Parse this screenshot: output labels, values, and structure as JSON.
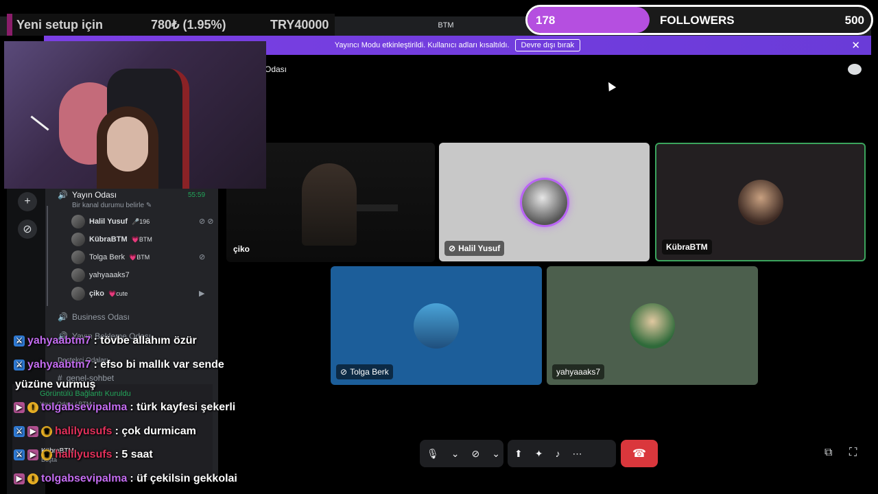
{
  "window": {
    "title": "BTM",
    "controls": [
      "⚑",
      "▣",
      "?",
      "–",
      "□"
    ]
  },
  "banner": {
    "text": "Yayıncı Modu etkinleştirildi. Kullanıcı adları kısaltıldı.",
    "button": "Devre dışı bırak",
    "close": "✕"
  },
  "rail": {
    "add_icon": "+",
    "explore_icon": "⊘"
  },
  "sidebar": {
    "voice_channel": {
      "name": "Yayın Odası",
      "status": "Bir kanal durumu belirle ✎",
      "time": "55:59"
    },
    "voice_users": [
      {
        "name": "Halil Yusuf",
        "tag": "🎤196",
        "icons": "⊘ ⊘"
      },
      {
        "name": "KübraBTM",
        "tag": "💗BTM",
        "icons": ""
      },
      {
        "name": "Tolga Berk",
        "tag": "💗BTM",
        "icons": "⊘"
      },
      {
        "name": "yahyaaaks7",
        "tag": "",
        "icons": ""
      },
      {
        "name": "çiko",
        "tag": "💗cute",
        "icons": "▶"
      }
    ],
    "channels": [
      "Business Odası",
      "Yayın Bekleme Odası",
      "Destekçi Odaları",
      "genel-sohbet"
    ],
    "connection": "Görüntülü Bağlantı Kuruldu",
    "connection_sub": "Yayın Odası / BTM",
    "user": {
      "name": "KübraBTM",
      "status": "Boşta"
    }
  },
  "main": {
    "channel_title": "Odası",
    "tiles": [
      {
        "name": "çiko"
      },
      {
        "name": "Halil Yusuf"
      },
      {
        "name": "KübraBTM"
      },
      {
        "name": "Tolga Berk"
      },
      {
        "name": "yahyaaaks7"
      }
    ]
  },
  "callbar": {
    "mic": "🎙",
    "mic_caret": "⌄",
    "cam": "⊘",
    "cam_caret": "⌄",
    "share": "⬆",
    "activities": "✦",
    "soundboard": "♪",
    "more": "⋯",
    "end": "☎",
    "popout": "⧉",
    "fullscreen": "⛶"
  },
  "overlay": {
    "ticker": {
      "label": "Yeni setup için",
      "price": "780₺ (1.95%)",
      "goal": "TRY40000"
    },
    "followers": {
      "current": "178",
      "label": "FOLLOWERS",
      "goal": "500",
      "progress": 0.356
    },
    "chat": [
      {
        "user": "yahyaabtm7",
        "text": ": tövbe allahım özür"
      },
      {
        "user": "yahyaabtm7",
        "text": ": efso bi mallık var sende",
        "cont": "yüzüne vurmuş"
      },
      {
        "user": "tolgabsevipalma",
        "text": ": türk kayfesi şekerli"
      },
      {
        "user": "halilyusufs",
        "text": ": çok durmicam"
      },
      {
        "user": "halilyusufs",
        "text": ": 5 saat"
      },
      {
        "user": "tolgabsevipalma",
        "text": ": üf çekilsin gekkolai"
      }
    ]
  },
  "colors": {
    "accent": "#b54fe0",
    "banner": "#6a3bd8",
    "end_call": "#da373c",
    "speaking": "#3ba55d"
  }
}
